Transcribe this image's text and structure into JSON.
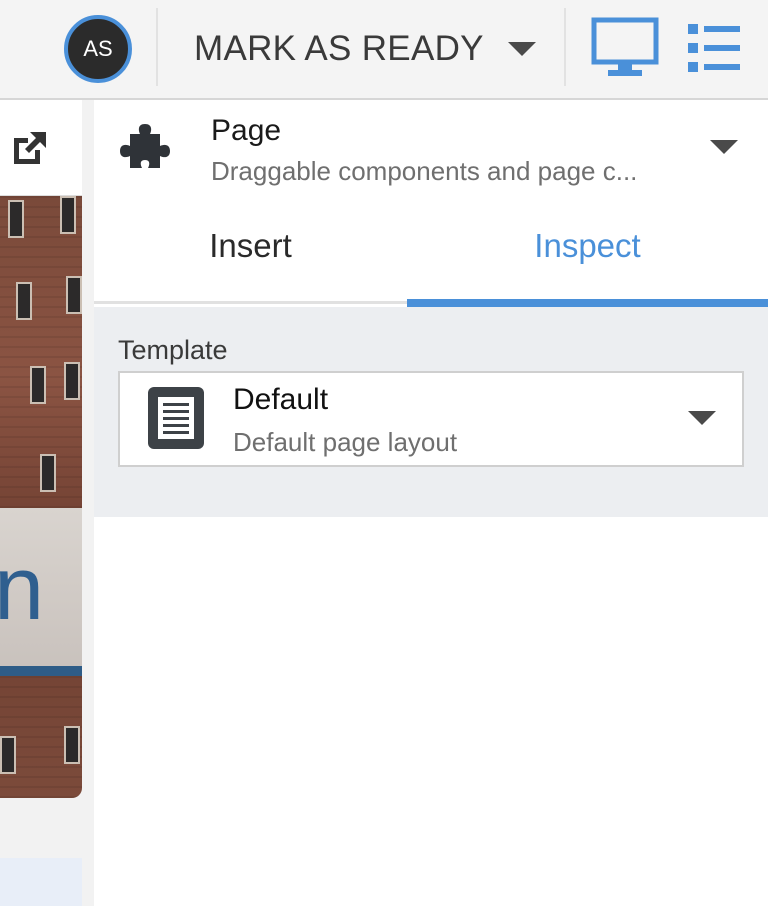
{
  "header": {
    "avatar_initials": "AS",
    "mark_ready_label": "MARK AS READY",
    "icons": [
      "chevron-down-icon",
      "monitor-icon",
      "list-icon"
    ],
    "accent_color": "#4a90d9"
  },
  "preview": {
    "icons": [
      "open-external-icon"
    ],
    "banner_glyph": "n"
  },
  "panel": {
    "component_title": "Page",
    "component_description": "Draggable components and page c...",
    "component_icon": "puzzle-icon",
    "tabs": [
      {
        "label": "Insert",
        "active": false
      },
      {
        "label": "Inspect",
        "active": true
      }
    ],
    "template": {
      "label": "Template",
      "selected_name": "Default",
      "selected_description": "Default page layout",
      "icon": "document-icon"
    }
  }
}
